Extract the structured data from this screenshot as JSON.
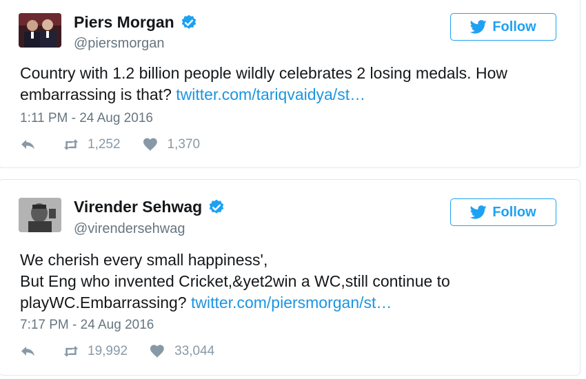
{
  "colors": {
    "accent": "#1da1f2",
    "link": "#1b95e0",
    "text": "#14171a",
    "muted": "#66757f",
    "icon": "#8899a6"
  },
  "tweets": [
    {
      "name": "Piers Morgan",
      "handle": "@piersmorgan",
      "follow_label": "Follow",
      "text_main": "Country with 1.2 billion people wildly celebrates 2 losing medals. How embarrassing is that?",
      "link": "twitter.com/tariqvaidya/st…",
      "timestamp": "1:11 PM - 24 Aug 2016",
      "retweets": "1,252",
      "likes": "1,370",
      "icons": [
        "verified-badge-icon",
        "twitter-bird-icon",
        "reply-icon",
        "retweet-icon",
        "heart-icon"
      ]
    },
    {
      "name": "Virender Sehwag",
      "handle": "@virendersehwag",
      "follow_label": "Follow",
      "text_line1": "We cherish every small happiness',",
      "text_line2": "But Eng who invented Cricket,&yet2win a WC,still continue to",
      "text_line3": "playWC.Embarrassing?",
      "link": "twitter.com/piersmorgan/st…",
      "timestamp": "7:17 PM - 24 Aug 2016",
      "retweets": "19,992",
      "likes": "33,044",
      "icons": [
        "verified-badge-icon",
        "twitter-bird-icon",
        "reply-icon",
        "retweet-icon",
        "heart-icon"
      ]
    }
  ]
}
